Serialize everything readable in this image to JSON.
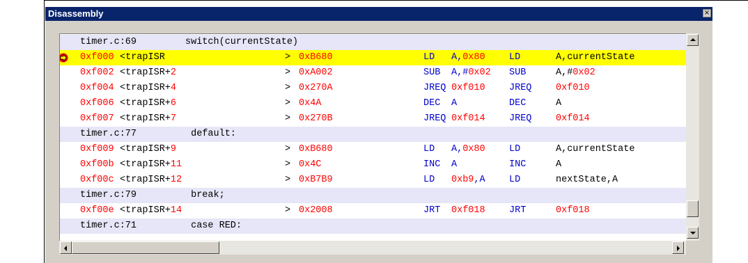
{
  "window": {
    "title": "Disassembly",
    "close_glyph": "×"
  },
  "colors": {
    "address": "#ff0000",
    "source": "#000000",
    "mnemonic": "#0000cc",
    "current_line": "#ffff00",
    "source_line_bg": "#e6e6f8"
  },
  "current_line_icon": "current-pc-arrow-icon",
  "rows": [
    {
      "kind": "source",
      "file": "timer.c:69",
      "code": "switch(currentState)"
    },
    {
      "kind": "asm",
      "current": true,
      "addr": "0xf000",
      "sym": "<trapISR",
      "off": "",
      "gt": ">",
      "hex": "0xB680",
      "mn": "LD",
      "op1": "A,0x80",
      "mn2": "LD",
      "op2a": "A,currentState",
      "op2b": ""
    },
    {
      "kind": "asm",
      "addr": "0xf002",
      "sym": "<trapISR+",
      "off": "2",
      "gt": ">",
      "hex": "0xA002",
      "mn": "SUB",
      "op1": "A,#0x02",
      "mn2": "SUB",
      "op2a": "A,#",
      "op2b": "0x02"
    },
    {
      "kind": "asm",
      "addr": "0xf004",
      "sym": "<trapISR+",
      "off": "4",
      "gt": ">",
      "hex": "0x270A",
      "mn": "JREQ",
      "op1": "0xf010",
      "mn2": "JREQ",
      "op2a": "",
      "op2b": "0xf010"
    },
    {
      "kind": "asm",
      "addr": "0xf006",
      "sym": "<trapISR+",
      "off": "6",
      "gt": ">",
      "hex": "0x4A",
      "mn": "DEC",
      "op1": "A",
      "mn2": "DEC",
      "op2a": "A",
      "op2b": ""
    },
    {
      "kind": "asm",
      "addr": "0xf007",
      "sym": "<trapISR+",
      "off": "7",
      "gt": ">",
      "hex": "0x270B",
      "mn": "JREQ",
      "op1": "0xf014",
      "mn2": "JREQ",
      "op2a": "",
      "op2b": "0xf014"
    },
    {
      "kind": "source",
      "file": "timer.c:77",
      "code": " default:"
    },
    {
      "kind": "asm",
      "addr": "0xf009",
      "sym": "<trapISR+",
      "off": "9",
      "gt": ">",
      "hex": "0xB680",
      "mn": "LD",
      "op1": "A,0x80",
      "mn2": "LD",
      "op2a": "A,currentState",
      "op2b": ""
    },
    {
      "kind": "asm",
      "addr": "0xf00b",
      "sym": "<trapISR+",
      "off": "11",
      "gt": ">",
      "hex": "0x4C",
      "mn": "INC",
      "op1": "A",
      "mn2": "INC",
      "op2a": "A",
      "op2b": ""
    },
    {
      "kind": "asm",
      "addr": "0xf00c",
      "sym": "<trapISR+",
      "off": "12",
      "gt": ">",
      "hex": "0xB7B9",
      "mn": "LD",
      "op1": "0xb9,A",
      "mn2": "LD",
      "op2a": "nextState,A",
      "op2b": ""
    },
    {
      "kind": "source",
      "file": "timer.c:79",
      "code": " break;"
    },
    {
      "kind": "asm",
      "addr": "0xf00e",
      "sym": "<trapISR+",
      "off": "14",
      "gt": ">",
      "hex": "0x2008",
      "mn": "JRT",
      "op1": "0xf018",
      "mn2": "JRT",
      "op2a": "",
      "op2b": "0xf018"
    },
    {
      "kind": "source",
      "file": "timer.c:71",
      "code": " case RED:"
    }
  ]
}
